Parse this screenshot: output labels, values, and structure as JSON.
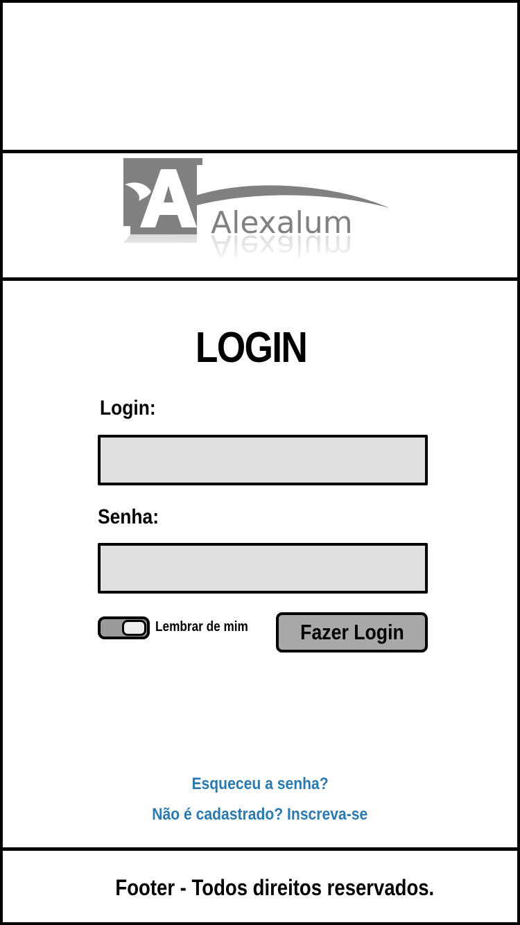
{
  "logo": {
    "brand_name": "Alexalum",
    "letter": "A",
    "color": "#808080"
  },
  "login_form": {
    "title": "LOGIN",
    "login_label": "Login:",
    "login_value": "",
    "password_label": "Senha:",
    "password_value": "",
    "remember_label": "Lembrar de mim",
    "remember_icon": "toggle-switch",
    "submit_label": "Fazer Login"
  },
  "links": {
    "forgot_password": "Esqueceu a senha?",
    "signup": "Não é cadastrado? Inscreva-se"
  },
  "footer": {
    "text": "Footer - Todos direitos reservados."
  },
  "colors": {
    "link": "#2a7ab0",
    "input_bg": "#e0e0e0",
    "button_bg": "#a8a8a8",
    "toggle_bg": "#9a9a9a"
  }
}
